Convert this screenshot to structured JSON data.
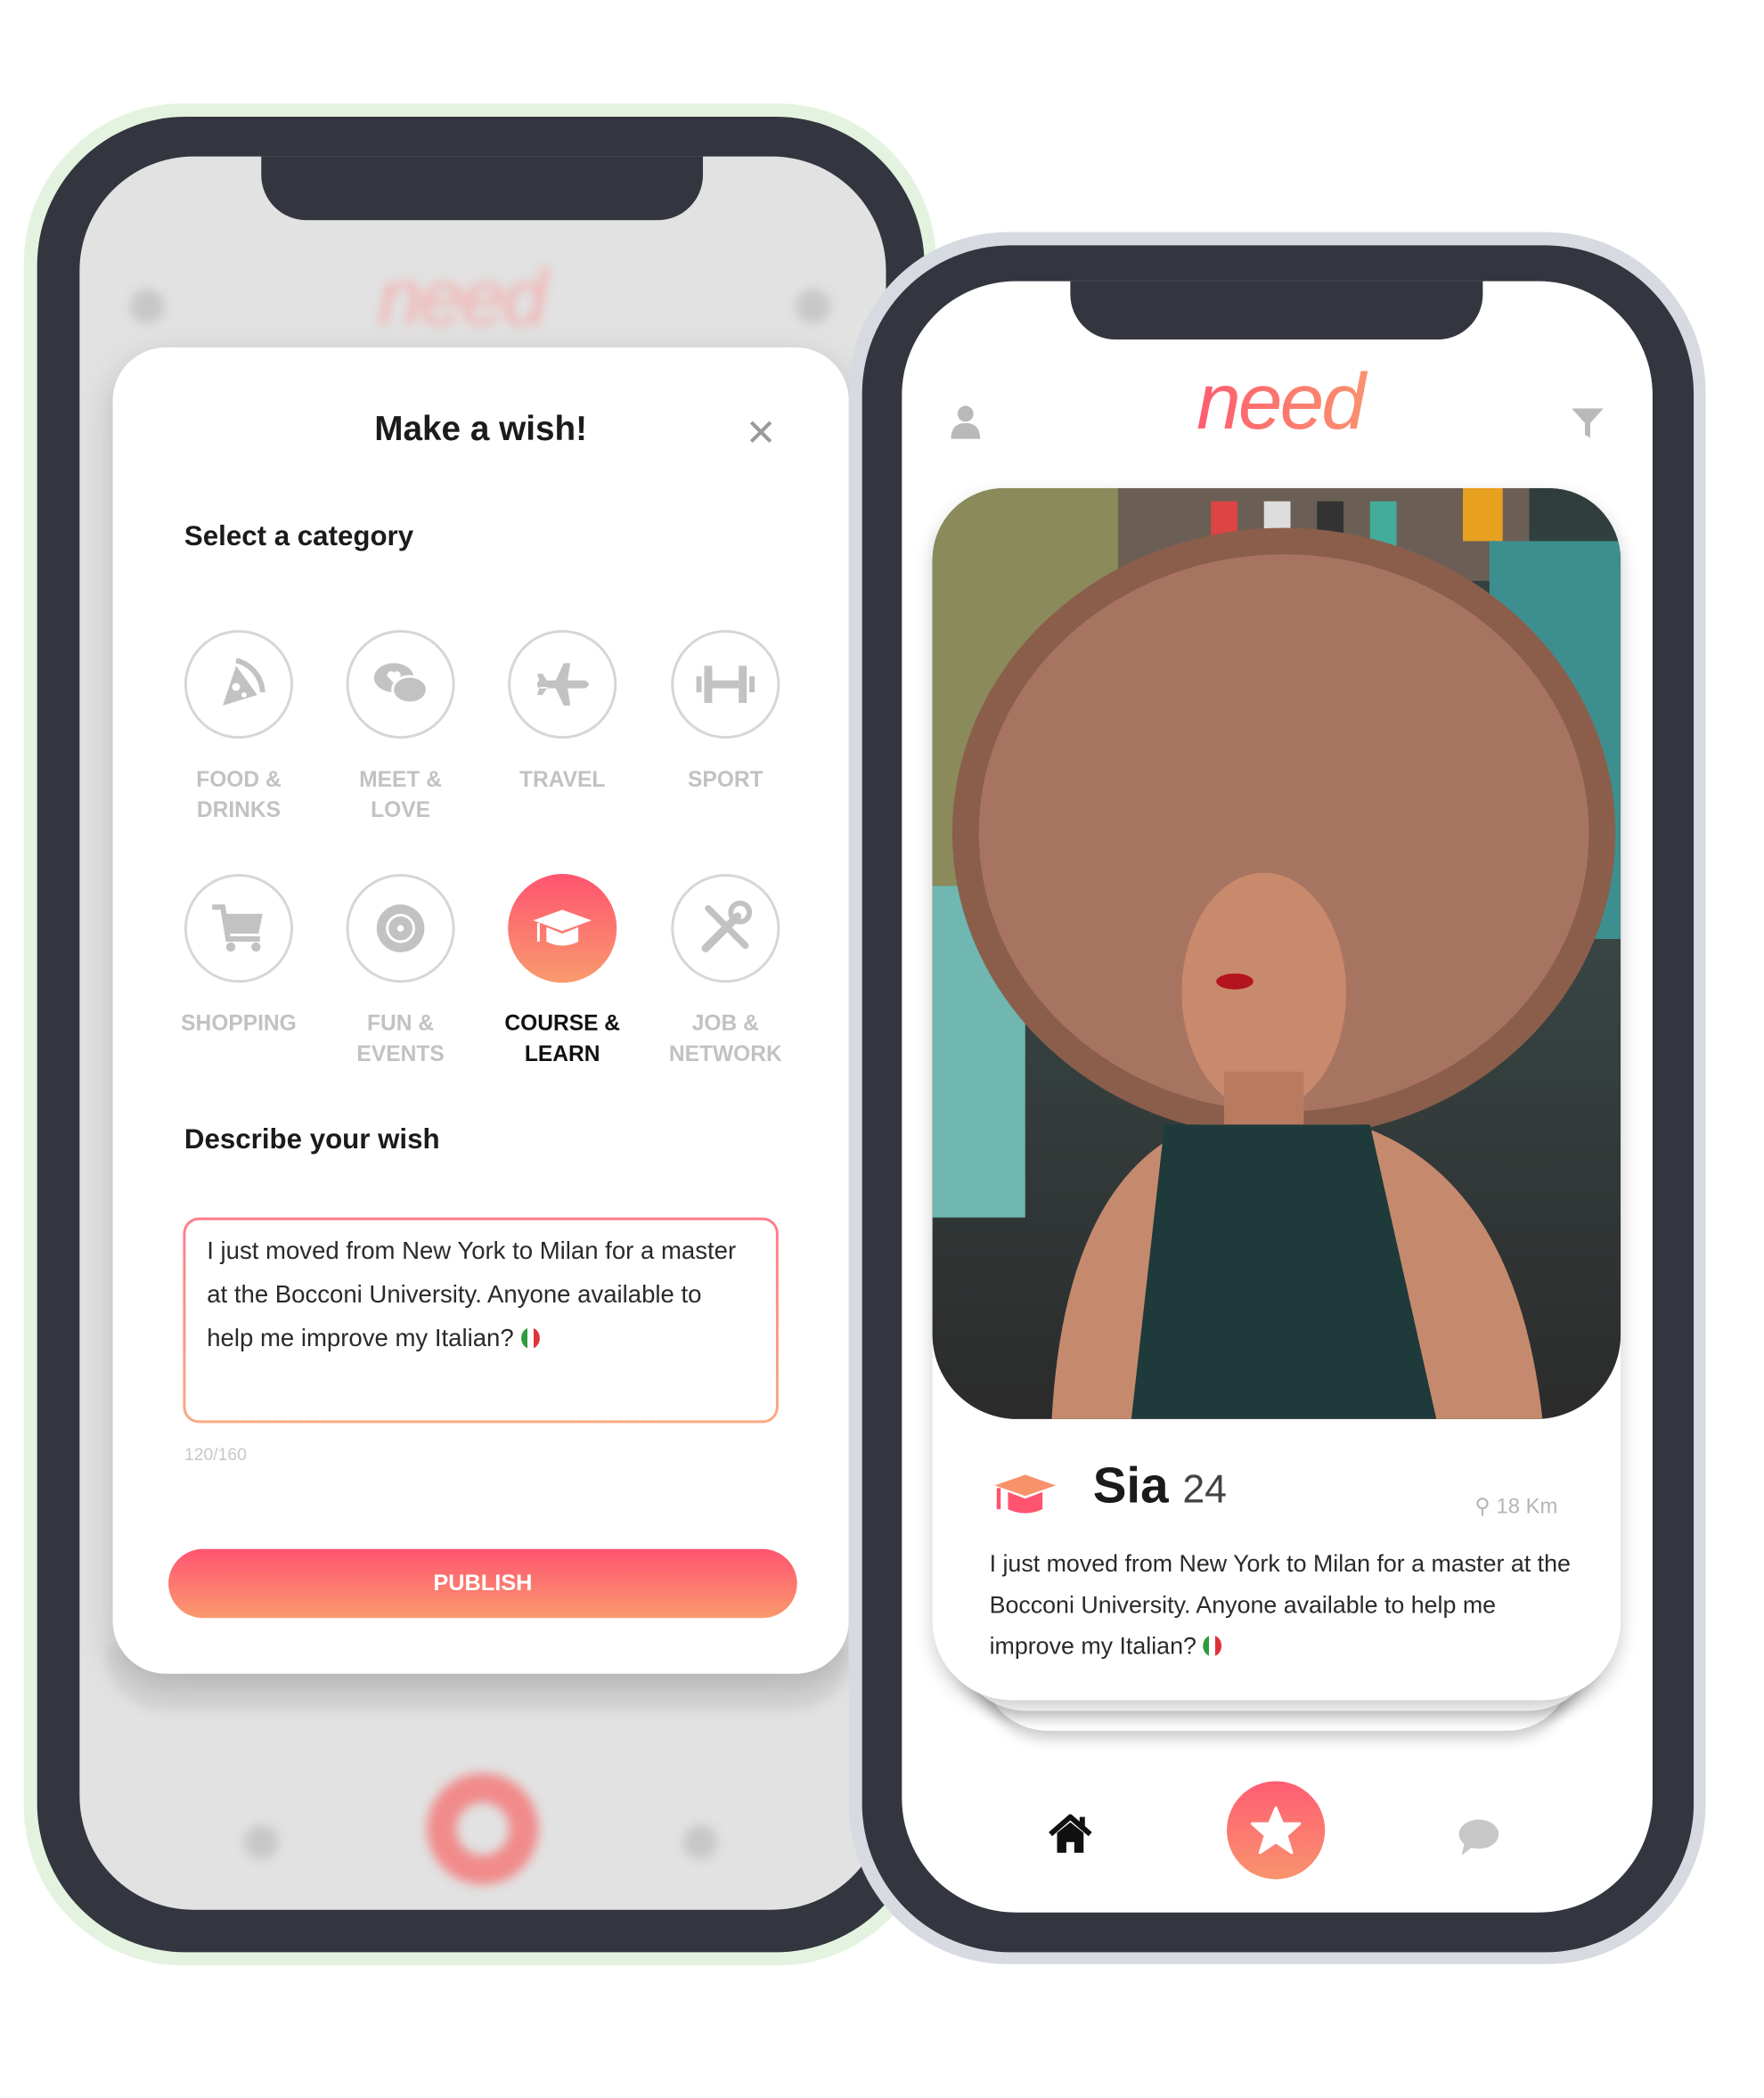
{
  "left_phone": {
    "background_logo": "need",
    "modal": {
      "title": "Make a wish!",
      "close_icon": "close-icon",
      "category_heading": "Select a category",
      "categories": [
        {
          "line1": "FOOD &",
          "line2": "DRINKS",
          "icon": "pizza-icon",
          "selected": false
        },
        {
          "line1": "MEET &",
          "line2": "LOVE",
          "icon": "chat-heart-icon",
          "selected": false
        },
        {
          "line1": "TRAVEL",
          "line2": "",
          "icon": "airplane-icon",
          "selected": false
        },
        {
          "line1": "SPORT",
          "line2": "",
          "icon": "dumbbell-icon",
          "selected": false
        },
        {
          "line1": "SHOPPING",
          "line2": "",
          "icon": "cart-icon",
          "selected": false
        },
        {
          "line1": "FUN &",
          "line2": "EVENTS",
          "icon": "disc-icon",
          "selected": false
        },
        {
          "line1": "COURSE &",
          "line2": "LEARN",
          "icon": "graduation-cap-icon",
          "selected": true
        },
        {
          "line1": "JOB &",
          "line2": "NETWORK",
          "icon": "tools-icon",
          "selected": false
        }
      ],
      "describe_heading": "Describe your wish",
      "wish_text": "I just moved from New York to Milan for a master at the Bocconi University. Anyone available to help me improve my Italian?",
      "char_counter": "120/160",
      "publish_label": "PUBLISH"
    }
  },
  "right_phone": {
    "logo": "need",
    "profile": {
      "name": "Sia",
      "age": "24",
      "distance": "18 Km",
      "category_icon": "graduation-cap-icon",
      "description": "I just moved from New York to Milan for a master at the Bocconi University. Anyone available to help me improve my Italian?"
    },
    "nav": [
      "home-icon",
      "star-icon",
      "chat-icon"
    ]
  },
  "colors": {
    "accent_start": "#ff5470",
    "accent_end": "#f99a6e",
    "frame": "#33363f"
  }
}
